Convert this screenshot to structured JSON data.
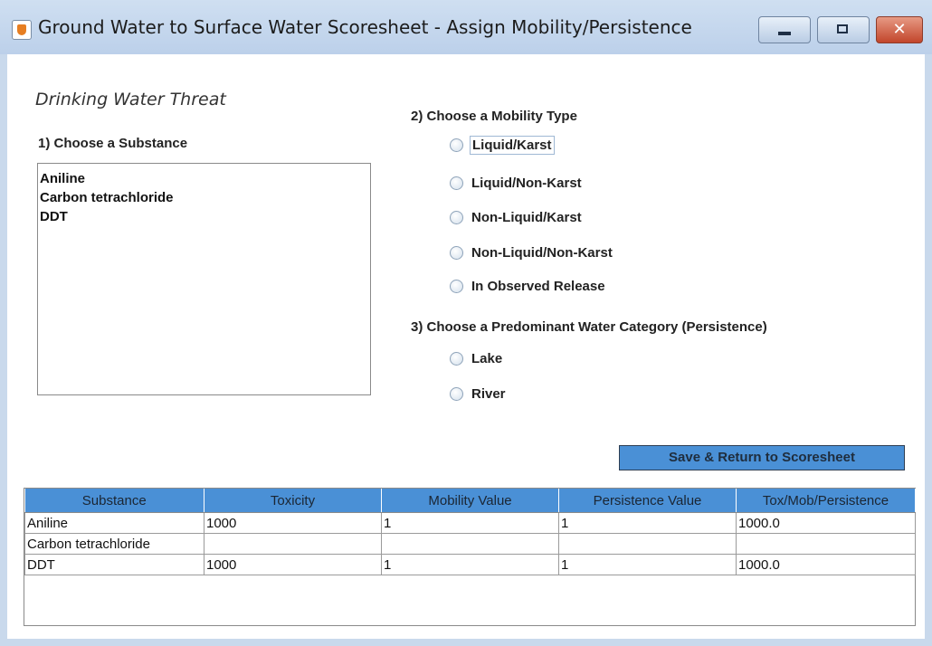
{
  "window": {
    "title": "Ground Water to Surface Water Scoresheet - Assign Mobility/Persistence",
    "buttons": {
      "minimize": "minimize",
      "maximize": "maximize",
      "close": "✕"
    }
  },
  "heading": "Drinking Water Threat",
  "substance_section": {
    "label": "1) Choose a Substance",
    "items": [
      "Aniline",
      "Carbon tetrachloride",
      "DDT"
    ]
  },
  "mobility_section": {
    "label": "2) Choose a Mobility Type",
    "options": [
      "Liquid/Karst",
      "Liquid/Non-Karst",
      "Non-Liquid/Karst",
      "Non-Liquid/Non-Karst",
      "In Observed Release"
    ]
  },
  "persistence_section": {
    "label": "3) Choose a Predominant Water Category (Persistence)",
    "options": [
      "Lake",
      "River"
    ]
  },
  "save_button": "Save & Return to Scoresheet",
  "table": {
    "headers": [
      "Substance",
      "Toxicity",
      "Mobility Value",
      "Persistence Value",
      "Tox/Mob/Persistence"
    ],
    "rows": [
      [
        "Aniline",
        "1000",
        "1",
        "1",
        "1000.0"
      ],
      [
        "Carbon tetrachloride",
        "",
        "",
        "",
        ""
      ],
      [
        "DDT",
        "1000",
        "1",
        "1",
        "1000.0"
      ]
    ]
  },
  "colors": {
    "accent": "#4a90d6",
    "close_button": "#c2452b",
    "titlebar": "#c9d9ec"
  },
  "icons": {
    "app": "java-cup-icon",
    "minimize": "minimize-icon",
    "maximize": "maximize-icon",
    "close": "close-icon"
  }
}
